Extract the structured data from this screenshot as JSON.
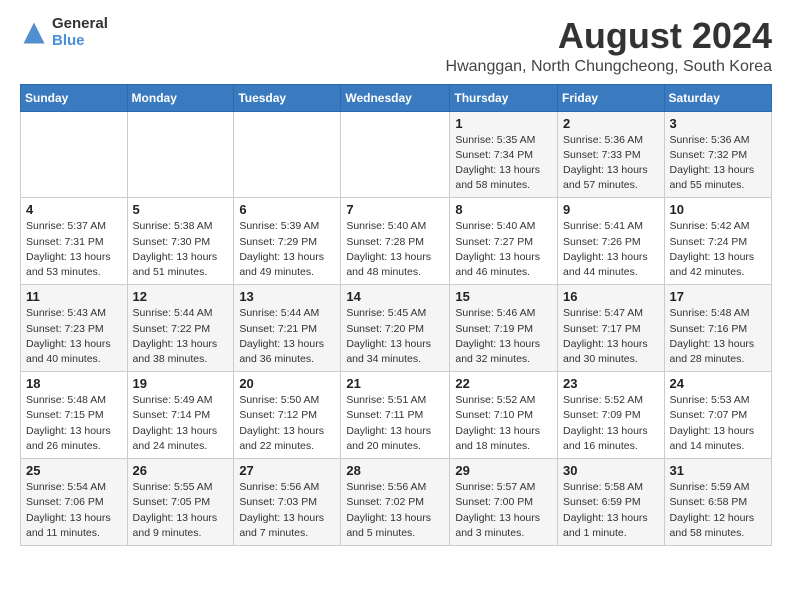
{
  "header": {
    "logo_general": "General",
    "logo_blue": "Blue",
    "main_title": "August 2024",
    "subtitle": "Hwanggan, North Chungcheong, South Korea"
  },
  "calendar": {
    "days_of_week": [
      "Sunday",
      "Monday",
      "Tuesday",
      "Wednesday",
      "Thursday",
      "Friday",
      "Saturday"
    ],
    "weeks": [
      [
        {
          "day": "",
          "info": ""
        },
        {
          "day": "",
          "info": ""
        },
        {
          "day": "",
          "info": ""
        },
        {
          "day": "",
          "info": ""
        },
        {
          "day": "1",
          "info": "Sunrise: 5:35 AM\nSunset: 7:34 PM\nDaylight: 13 hours\nand 58 minutes."
        },
        {
          "day": "2",
          "info": "Sunrise: 5:36 AM\nSunset: 7:33 PM\nDaylight: 13 hours\nand 57 minutes."
        },
        {
          "day": "3",
          "info": "Sunrise: 5:36 AM\nSunset: 7:32 PM\nDaylight: 13 hours\nand 55 minutes."
        }
      ],
      [
        {
          "day": "4",
          "info": "Sunrise: 5:37 AM\nSunset: 7:31 PM\nDaylight: 13 hours\nand 53 minutes."
        },
        {
          "day": "5",
          "info": "Sunrise: 5:38 AM\nSunset: 7:30 PM\nDaylight: 13 hours\nand 51 minutes."
        },
        {
          "day": "6",
          "info": "Sunrise: 5:39 AM\nSunset: 7:29 PM\nDaylight: 13 hours\nand 49 minutes."
        },
        {
          "day": "7",
          "info": "Sunrise: 5:40 AM\nSunset: 7:28 PM\nDaylight: 13 hours\nand 48 minutes."
        },
        {
          "day": "8",
          "info": "Sunrise: 5:40 AM\nSunset: 7:27 PM\nDaylight: 13 hours\nand 46 minutes."
        },
        {
          "day": "9",
          "info": "Sunrise: 5:41 AM\nSunset: 7:26 PM\nDaylight: 13 hours\nand 44 minutes."
        },
        {
          "day": "10",
          "info": "Sunrise: 5:42 AM\nSunset: 7:24 PM\nDaylight: 13 hours\nand 42 minutes."
        }
      ],
      [
        {
          "day": "11",
          "info": "Sunrise: 5:43 AM\nSunset: 7:23 PM\nDaylight: 13 hours\nand 40 minutes."
        },
        {
          "day": "12",
          "info": "Sunrise: 5:44 AM\nSunset: 7:22 PM\nDaylight: 13 hours\nand 38 minutes."
        },
        {
          "day": "13",
          "info": "Sunrise: 5:44 AM\nSunset: 7:21 PM\nDaylight: 13 hours\nand 36 minutes."
        },
        {
          "day": "14",
          "info": "Sunrise: 5:45 AM\nSunset: 7:20 PM\nDaylight: 13 hours\nand 34 minutes."
        },
        {
          "day": "15",
          "info": "Sunrise: 5:46 AM\nSunset: 7:19 PM\nDaylight: 13 hours\nand 32 minutes."
        },
        {
          "day": "16",
          "info": "Sunrise: 5:47 AM\nSunset: 7:17 PM\nDaylight: 13 hours\nand 30 minutes."
        },
        {
          "day": "17",
          "info": "Sunrise: 5:48 AM\nSunset: 7:16 PM\nDaylight: 13 hours\nand 28 minutes."
        }
      ],
      [
        {
          "day": "18",
          "info": "Sunrise: 5:48 AM\nSunset: 7:15 PM\nDaylight: 13 hours\nand 26 minutes."
        },
        {
          "day": "19",
          "info": "Sunrise: 5:49 AM\nSunset: 7:14 PM\nDaylight: 13 hours\nand 24 minutes."
        },
        {
          "day": "20",
          "info": "Sunrise: 5:50 AM\nSunset: 7:12 PM\nDaylight: 13 hours\nand 22 minutes."
        },
        {
          "day": "21",
          "info": "Sunrise: 5:51 AM\nSunset: 7:11 PM\nDaylight: 13 hours\nand 20 minutes."
        },
        {
          "day": "22",
          "info": "Sunrise: 5:52 AM\nSunset: 7:10 PM\nDaylight: 13 hours\nand 18 minutes."
        },
        {
          "day": "23",
          "info": "Sunrise: 5:52 AM\nSunset: 7:09 PM\nDaylight: 13 hours\nand 16 minutes."
        },
        {
          "day": "24",
          "info": "Sunrise: 5:53 AM\nSunset: 7:07 PM\nDaylight: 13 hours\nand 14 minutes."
        }
      ],
      [
        {
          "day": "25",
          "info": "Sunrise: 5:54 AM\nSunset: 7:06 PM\nDaylight: 13 hours\nand 11 minutes."
        },
        {
          "day": "26",
          "info": "Sunrise: 5:55 AM\nSunset: 7:05 PM\nDaylight: 13 hours\nand 9 minutes."
        },
        {
          "day": "27",
          "info": "Sunrise: 5:56 AM\nSunset: 7:03 PM\nDaylight: 13 hours\nand 7 minutes."
        },
        {
          "day": "28",
          "info": "Sunrise: 5:56 AM\nSunset: 7:02 PM\nDaylight: 13 hours\nand 5 minutes."
        },
        {
          "day": "29",
          "info": "Sunrise: 5:57 AM\nSunset: 7:00 PM\nDaylight: 13 hours\nand 3 minutes."
        },
        {
          "day": "30",
          "info": "Sunrise: 5:58 AM\nSunset: 6:59 PM\nDaylight: 13 hours\nand 1 minute."
        },
        {
          "day": "31",
          "info": "Sunrise: 5:59 AM\nSunset: 6:58 PM\nDaylight: 12 hours\nand 58 minutes."
        }
      ]
    ]
  }
}
